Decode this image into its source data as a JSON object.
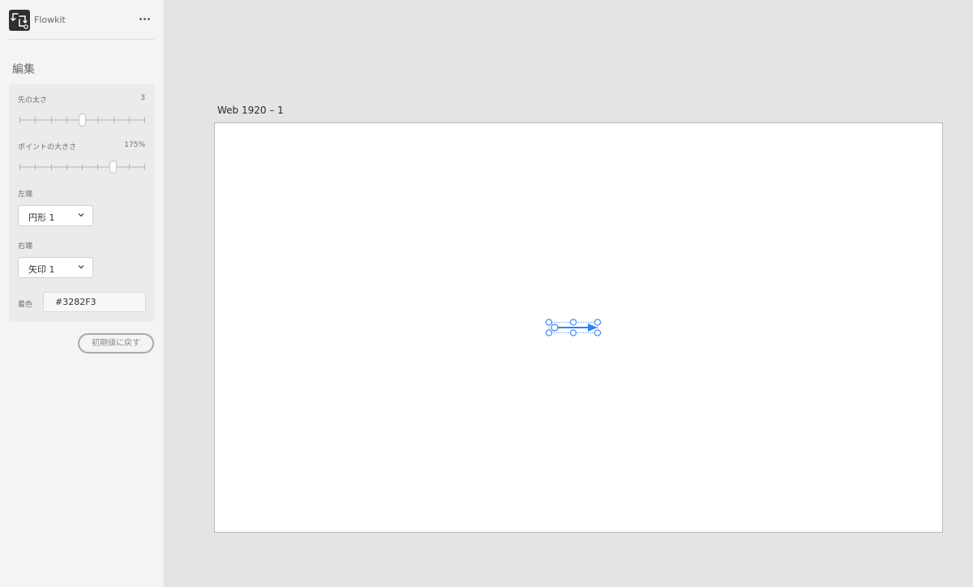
{
  "plugin": {
    "name": "Flowkit",
    "more_icon": "more-horizontal-icon",
    "logo_icon": "flowkit-logo-icon"
  },
  "panel": {
    "title": "編集",
    "line_width": {
      "label": "先の太さ",
      "value": "3",
      "level_fraction": 0.5
    },
    "point_size": {
      "label": "ポイントの大きさ",
      "value": "175%",
      "level_fraction": 0.75
    },
    "left_end": {
      "label": "左端",
      "selected": "円形 1"
    },
    "right_end": {
      "label": "右端",
      "selected": "矢印 1"
    },
    "color": {
      "label": "着色",
      "value": "#3282F3"
    },
    "reset_label": "初期値に戻す"
  },
  "canvas": {
    "artboard_label": "Web 1920 – 1",
    "connector_color": "#3282F3"
  }
}
